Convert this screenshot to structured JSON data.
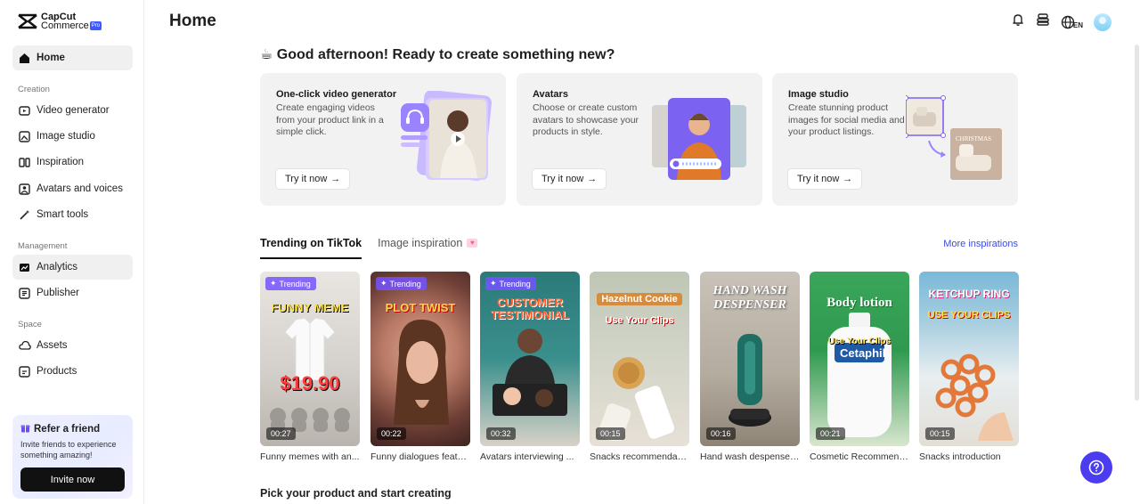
{
  "app": {
    "logo_line1": "CapCut",
    "logo_line2": "Commerce",
    "logo_badge": "Pro"
  },
  "sidebar": {
    "items": [
      {
        "label": "Home",
        "icon": "home-icon"
      },
      {
        "label": "Video generator",
        "icon": "video-generator-icon"
      },
      {
        "label": "Image studio",
        "icon": "image-studio-icon"
      },
      {
        "label": "Inspiration",
        "icon": "inspiration-icon"
      },
      {
        "label": "Avatars and voices",
        "icon": "avatar-icon"
      },
      {
        "label": "Smart tools",
        "icon": "magic-wand-icon"
      },
      {
        "label": "Analytics",
        "icon": "analytics-icon"
      },
      {
        "label": "Publisher",
        "icon": "publisher-icon"
      },
      {
        "label": "Assets",
        "icon": "cloud-icon"
      },
      {
        "label": "Products",
        "icon": "product-box-icon"
      }
    ],
    "sections": {
      "creation": "Creation",
      "management": "Management",
      "space": "Space"
    },
    "refer": {
      "title": "Refer a friend",
      "desc": "Invite friends to experience something amazing!",
      "button": "Invite now"
    }
  },
  "header": {
    "title": "Home",
    "lang": "EN"
  },
  "greeting": "☕ Good afternoon! Ready to create something new?",
  "features": [
    {
      "title": "One-click video generator",
      "desc": "Create engaging videos from your product link in a simple click.",
      "button": "Try it now"
    },
    {
      "title": "Avatars",
      "desc": "Choose or create custom avatars to showcase your products in style.",
      "button": "Try it now"
    },
    {
      "title": "Image studio",
      "desc": "Create stunning product images for social media and your product listings.",
      "button": "Try it now"
    }
  ],
  "tabs": [
    {
      "label": "Trending on TikTok"
    },
    {
      "label": "Image inspiration"
    }
  ],
  "more_link": "More inspirations",
  "trending_badge": "Trending",
  "videos": [
    {
      "duration": "00:27",
      "label": "Funny memes with an...",
      "caption": "FUNNY MEME",
      "price": "$19.90"
    },
    {
      "duration": "00:22",
      "label": "Funny dialogues featu...",
      "caption": "PLOT TWIST"
    },
    {
      "duration": "00:32",
      "label": "Avatars interviewing ...",
      "caption": "CUSTOMER TESTIMONIAL"
    },
    {
      "duration": "00:15",
      "label": "Snacks recommendati...",
      "caption": "Hazelnut Cookie",
      "sub": "Use Your Clips"
    },
    {
      "duration": "00:16",
      "label": "Hand wash despenser...",
      "caption": "HAND WASH DESPENSER"
    },
    {
      "duration": "00:21",
      "label": "Cosmetic Recommend...",
      "caption": "Body lotion",
      "sub": "Use Your Clips"
    },
    {
      "duration": "00:15",
      "label": "Snacks introduction",
      "caption": "KETCHUP RING",
      "sub": "USE YOUR CLIPS"
    }
  ],
  "pick_title": "Pick your product and start creating"
}
